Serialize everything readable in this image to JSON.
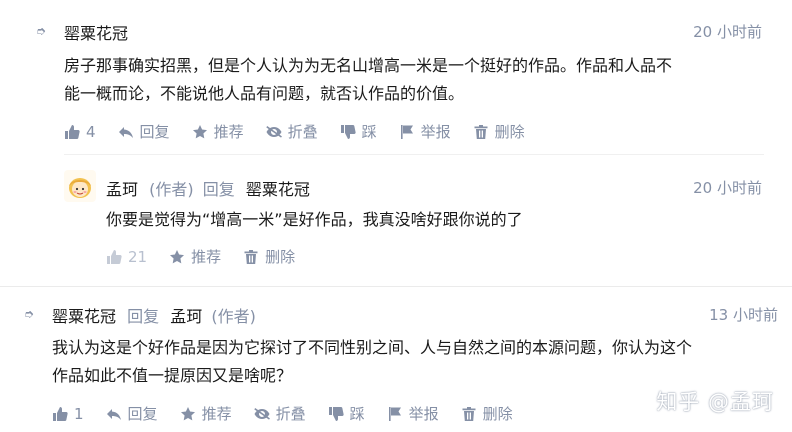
{
  "comment1": {
    "author": "罂粟花冠",
    "time": "20 小时前",
    "line1": "房子那事确实招黑，但是个人认为为无名山增高一米是一个挺好的作品。作品和人品不",
    "line2": "能一概而论，不能说他人品有问题，就否认作品的价值。",
    "actions": {
      "like_count": "4",
      "reply": "回复",
      "recommend": "推荐",
      "collapse": "折叠",
      "dislike": "踩",
      "report": "举报",
      "delete": "删除"
    }
  },
  "reply1": {
    "author": "孟珂",
    "author_tag": "(作者)",
    "reply_word": "回复",
    "reply_to": "罂粟花冠",
    "time": "20 小时前",
    "text": "你要是觉得为“增高一米”是好作品，我真没啥好跟你说的了",
    "actions": {
      "like_count": "21",
      "recommend": "推荐",
      "delete": "删除"
    }
  },
  "comment2": {
    "author": "罂粟花冠",
    "reply_word": "回复",
    "reply_to": "孟珂",
    "reply_to_tag": "(作者)",
    "time": "13 小时前",
    "line1": "我认为这是个好作品是因为它探讨了不同性别之间、人与自然之间的本源问题，你认为这个",
    "line2": "作品如此不值一提原因又是啥呢？",
    "actions": {
      "like_count": "1",
      "reply": "回复",
      "recommend": "推荐",
      "collapse": "折叠",
      "dislike": "踩",
      "report": "举报",
      "delete": "删除"
    }
  },
  "watermark": "知乎 @孟珂",
  "colors": {
    "text": "#1a1a1a",
    "muted": "#8590a6",
    "divider": "#ebebeb"
  }
}
